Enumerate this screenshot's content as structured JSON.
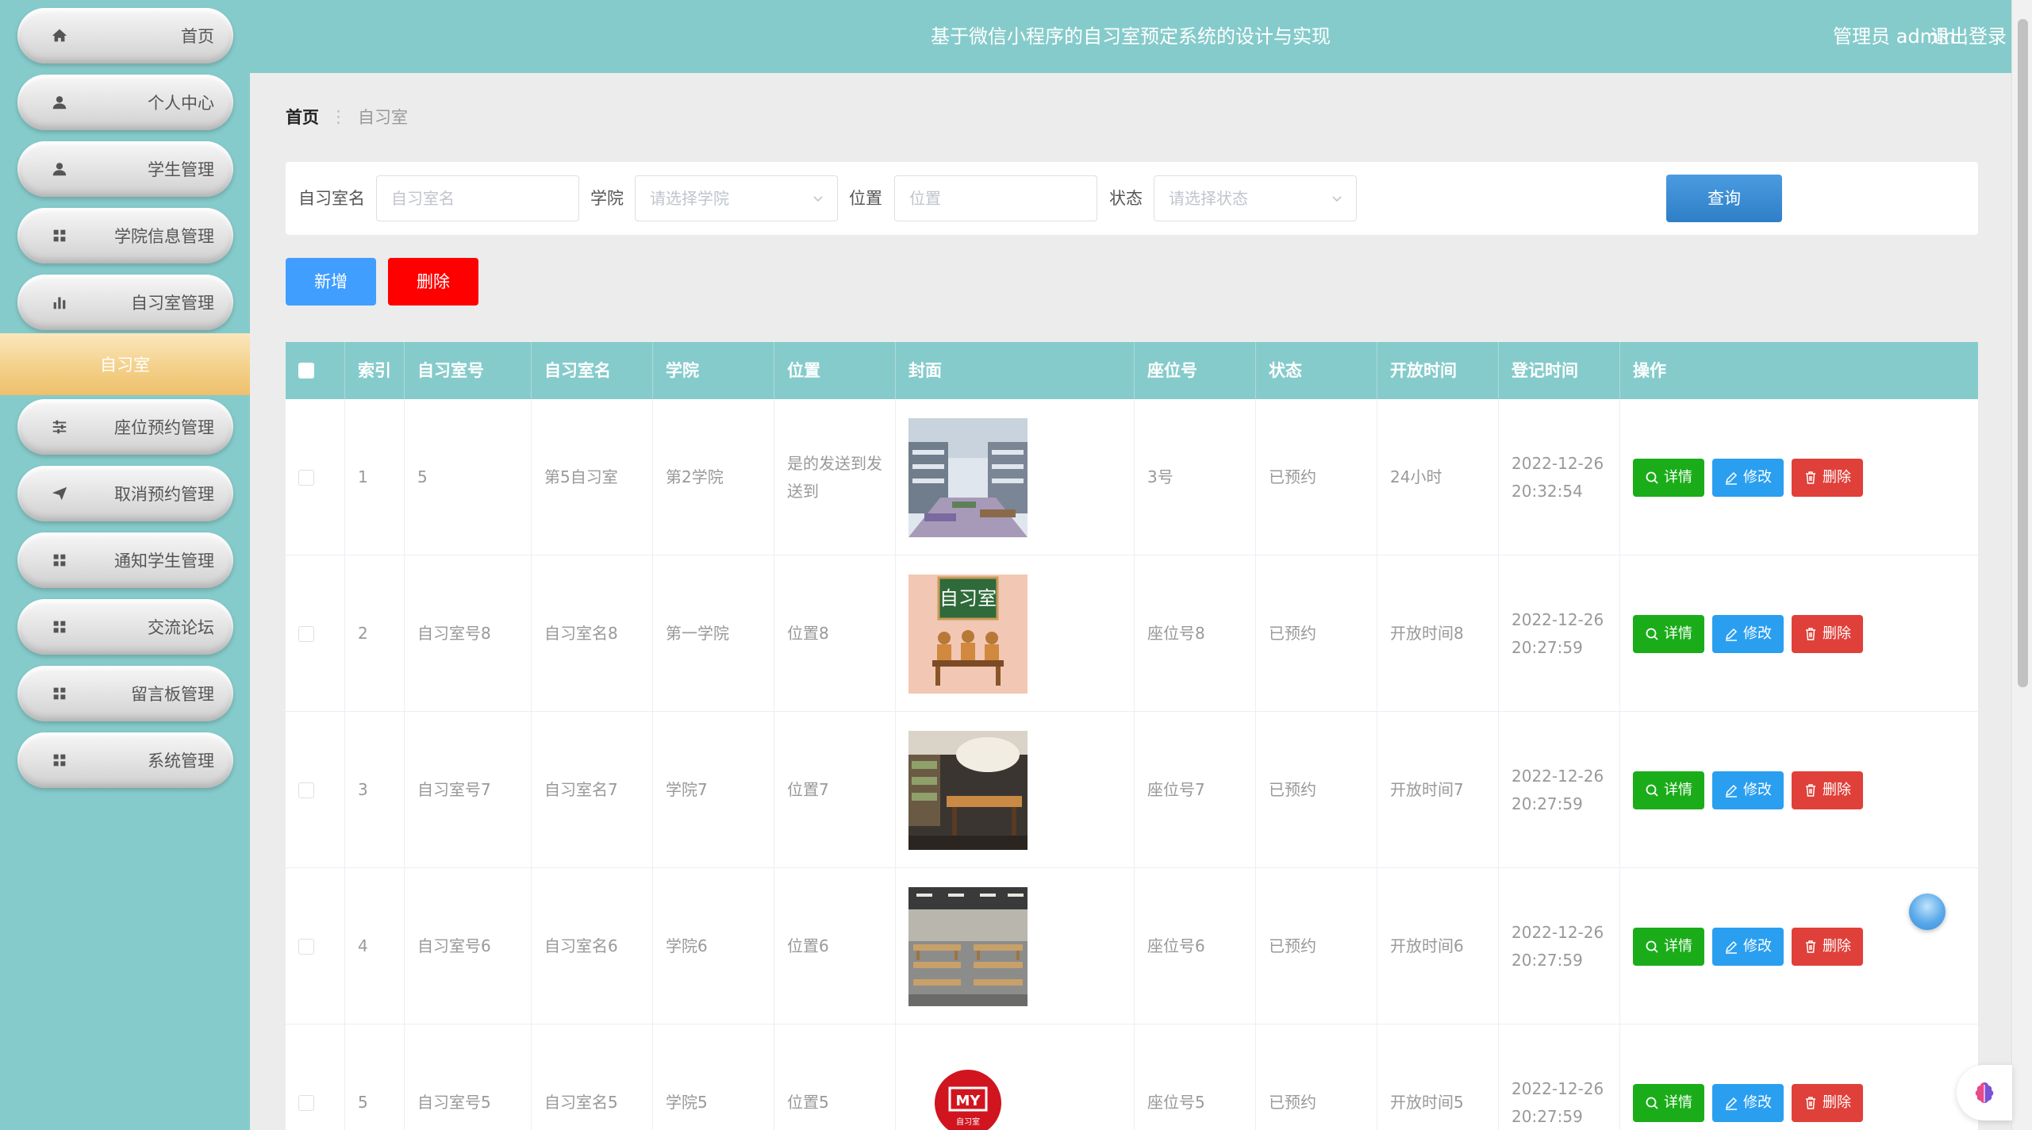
{
  "header": {
    "title": "基于微信小程序的自习室预定系统的设计与实现",
    "user": "管理员 admin",
    "logout": "退出登录"
  },
  "sidebar": {
    "items": [
      {
        "label": "首页",
        "icon": "home-icon"
      },
      {
        "label": "个人中心",
        "icon": "user-icon"
      },
      {
        "label": "学生管理",
        "icon": "user-icon"
      },
      {
        "label": "学院信息管理",
        "icon": "grid-icon"
      },
      {
        "label": "自习室管理",
        "icon": "bar-chart-icon"
      },
      {
        "label": "座位预约管理",
        "icon": "sliders-icon"
      },
      {
        "label": "取消预约管理",
        "icon": "send-icon"
      },
      {
        "label": "通知学生管理",
        "icon": "grid-icon"
      },
      {
        "label": "交流论坛",
        "icon": "grid-icon"
      },
      {
        "label": "留言板管理",
        "icon": "grid-icon"
      },
      {
        "label": "系统管理",
        "icon": "grid-icon"
      }
    ],
    "active_sub": "自习室"
  },
  "breadcrumb": {
    "home": "首页",
    "sep": "⋮",
    "current": "自习室"
  },
  "search": {
    "name_label": "自习室名",
    "name_placeholder": "自习室名",
    "college_label": "学院",
    "college_placeholder": "请选择学院",
    "location_label": "位置",
    "location_placeholder": "位置",
    "status_label": "状态",
    "status_placeholder": "请选择状态",
    "query": "查询"
  },
  "actions": {
    "add": "新增",
    "delete": "删除"
  },
  "table": {
    "headers": [
      "索引",
      "自习室号",
      "自习室名",
      "学院",
      "位置",
      "封面",
      "座位号",
      "状态",
      "开放时间",
      "登记时间",
      "操作"
    ],
    "op_labels": {
      "detail": "详情",
      "edit": "修改",
      "delete": "删除"
    },
    "rows": [
      {
        "index": "1",
        "room_no": "5",
        "room_name": "第5自习室",
        "college": "第2学院",
        "location": "是的发送到发送到",
        "seat": "3号",
        "status": "已预约",
        "open_time": "24小时",
        "reg_date": "2022-12-26",
        "reg_time": "20:32:54"
      },
      {
        "index": "2",
        "room_no": "自习室号8",
        "room_name": "自习室名8",
        "college": "第一学院",
        "location": "位置8",
        "seat": "座位号8",
        "status": "已预约",
        "open_time": "开放时间8",
        "reg_date": "2022-12-26",
        "reg_time": "20:27:59"
      },
      {
        "index": "3",
        "room_no": "自习室号7",
        "room_name": "自习室名7",
        "college": "学院7",
        "location": "位置7",
        "seat": "座位号7",
        "status": "已预约",
        "open_time": "开放时间7",
        "reg_date": "2022-12-26",
        "reg_time": "20:27:59"
      },
      {
        "index": "4",
        "room_no": "自习室号6",
        "room_name": "自习室名6",
        "college": "学院6",
        "location": "位置6",
        "seat": "座位号6",
        "status": "已预约",
        "open_time": "开放时间6",
        "reg_date": "2022-12-26",
        "reg_time": "20:27:59"
      },
      {
        "index": "5",
        "room_no": "自习室号5",
        "room_name": "自习室名5",
        "college": "学院5",
        "location": "位置5",
        "seat": "座位号5",
        "status": "已预约",
        "open_time": "开放时间5",
        "reg_date": "2022-12-26",
        "reg_time": "20:27:59"
      }
    ],
    "cover_texts": {
      "row2": "自习室",
      "row5_logo": "MY",
      "row5_sub": "自习室"
    }
  },
  "colors": {
    "theme": "#86cbcb",
    "active": "#f3cf86",
    "primary": "#409eff",
    "danger": "#ff0000",
    "success": "#1aad19"
  }
}
